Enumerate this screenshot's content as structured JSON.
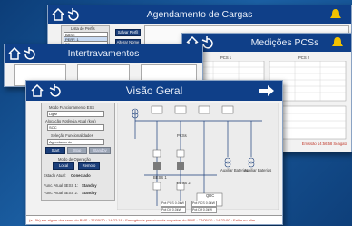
{
  "windows": {
    "agendamento": {
      "title": "Agendamento de Cargas",
      "list_header": "Lista de Perfis",
      "profiles": [
        "BASE",
        "PERF. 1",
        "P2"
      ],
      "save_profile": "Salvar Perfil",
      "change_name": "Alterar Nome"
    },
    "intertravamentos": {
      "title": "Intertravamentos"
    },
    "medicoes": {
      "title": "Medições PCSs",
      "footer_note": "Emissão 14:56:58 Seagata",
      "headers": [
        "PCS 1",
        "PCS 2"
      ]
    },
    "visao": {
      "title": "Visão Geral",
      "modo_label": "Modo Funcionamento ESS",
      "modo_value": "Ligar",
      "alocacao_label": "Alocação Potência Atual (kva)",
      "alocacao_value": "SOC",
      "selecao_label": "Seleção Funcionalidades",
      "selecao_value": "Agendamento",
      "start": "Start",
      "stop": "Stop",
      "standby": "Standby",
      "modo_operacao": "Modo de Operação",
      "local": "Local",
      "remoto": "Remoto",
      "estado_label": "Estado Atual:",
      "estado_value": "Conectado",
      "func1_label": "Func. Atual BESS 1:",
      "func1_value": "Standby",
      "func2_label": "Func. Atual BESS 2:",
      "func2_value": "Standby",
      "pcs_label": "PCSs",
      "bess1": "BESS 1",
      "bess2": "BESS 2",
      "pcs1": "PCS 1",
      "pcs2": "PCS 2",
      "aux1": "Auxiliar Baterias",
      "aux2": "Auxiliar Baterias",
      "qdc": "QDC",
      "pot_lines": [
        "Pot PCS 0.0kW",
        "Pot Dif 0.0kW",
        "Pot PCS 0.0kW",
        "Pot Dif 0.0kW"
      ],
      "ticker": "(a.15h) em algum dos ramo do BMS · 27/05/20 · 14:22:18 · Emergência pressionada no painel do BMS · 27/05/20 · 14:23:00 · Falha no alim"
    }
  },
  "colors": {
    "titlebar": "#0f3f88",
    "accent_yellow": "#f2c200",
    "background": "#1b5fa3"
  }
}
